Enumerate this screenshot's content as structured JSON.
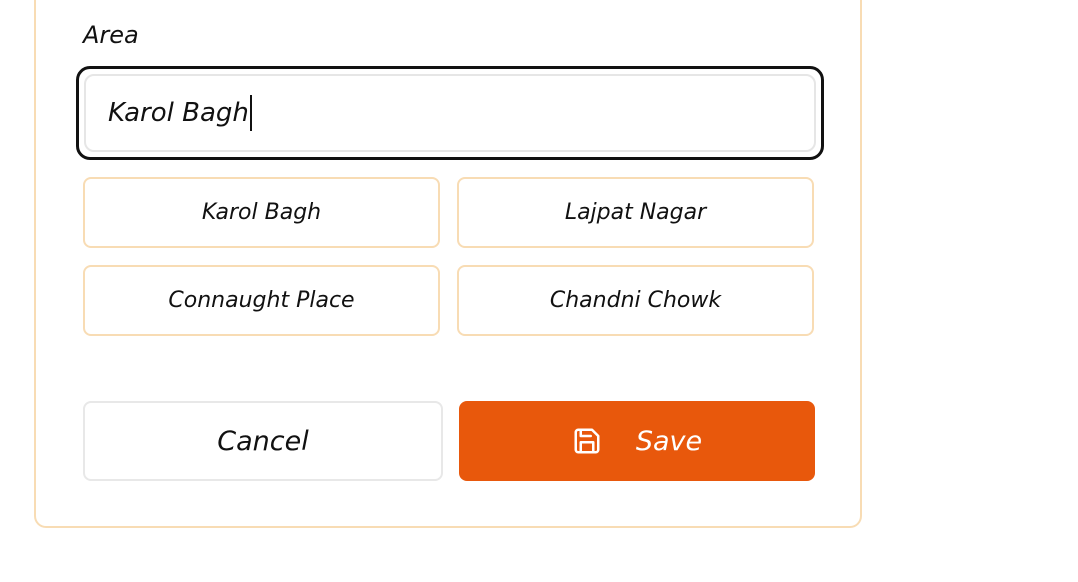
{
  "area": {
    "label": "Area",
    "input_value": "Karol Bagh",
    "suggestions": [
      "Karol Bagh",
      "Lajpat Nagar",
      "Connaught Place",
      "Chandni Chowk"
    ]
  },
  "actions": {
    "cancel_label": "Cancel",
    "save_label": "Save",
    "save_icon": "save-icon"
  },
  "colors": {
    "accent": "#e8580c",
    "card_border": "#f8dcb4",
    "focus_border": "#111111"
  }
}
